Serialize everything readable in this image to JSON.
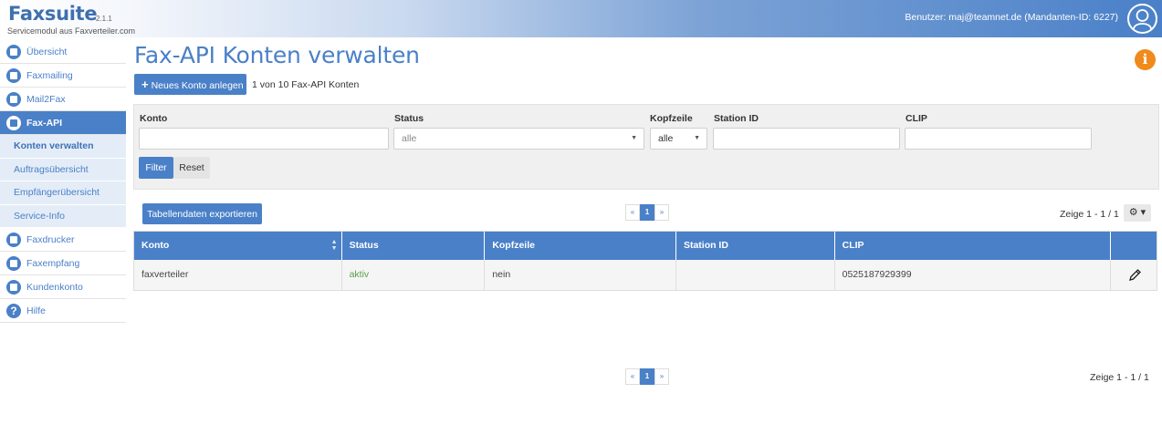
{
  "header": {
    "logo": "Faxsuite",
    "version": "2.1.1",
    "subtitle": "Servicemodul aus Faxverteiler.com",
    "user_info": "Benutzer: maj@teamnet.de (Mandanten-ID: 6227)",
    "avatar_icon": "user-icon"
  },
  "sidebar": {
    "items": [
      {
        "label": "Übersicht",
        "icon": "overview-icon"
      },
      {
        "label": "Faxmailing",
        "icon": "faxmailing-icon"
      },
      {
        "label": "Mail2Fax",
        "icon": "mail2fax-icon"
      },
      {
        "label": "Fax-API",
        "icon": "fax-api-icon"
      },
      {
        "label": "Faxdrucker",
        "icon": "faxdrucker-icon"
      },
      {
        "label": "Faxempfang",
        "icon": "faxempfang-icon"
      },
      {
        "label": "Kundenkonto",
        "icon": "kundenkonto-icon"
      },
      {
        "label": "Hilfe",
        "icon": "help-icon",
        "glyph": "?"
      }
    ],
    "subitems": [
      {
        "label": "Konten verwalten"
      },
      {
        "label": "Auftragsübersicht"
      },
      {
        "label": "Empfängerübersicht"
      },
      {
        "label": "Service-Info"
      }
    ]
  },
  "main": {
    "title": "Fax-API Konten verwalten",
    "info_glyph": "i",
    "new_account_plus": "+",
    "new_account_label": "Neues Konto anlegen",
    "count_text": "1 von 10 Fax-API Konten"
  },
  "filter": {
    "konto_label": "Konto",
    "konto_value": "",
    "status_label": "Status",
    "status_value": "alle",
    "kopfzeile_label": "Kopfzeile",
    "kopfzeile_value": "alle",
    "station_label": "Station ID",
    "station_value": "",
    "clip_label": "CLIP",
    "clip_value": "",
    "filter_button": "Filter",
    "reset_button": "Reset"
  },
  "table_toolbar": {
    "export_label": "Tabellendaten exportieren",
    "pager": {
      "prev": "«",
      "current": "1",
      "next": "»"
    },
    "show_text": "Zeige 1 - 1 / 1",
    "gear_label": "⚙ ▾"
  },
  "table": {
    "columns": [
      "Konto",
      "Status",
      "Kopfzeile",
      "Station ID",
      "CLIP",
      ""
    ],
    "rows": [
      {
        "konto": "faxverteiler",
        "status": "aktiv",
        "kopfzeile": "nein",
        "station_id": "",
        "clip": "0525187929399"
      }
    ]
  },
  "footer_pager": {
    "pager": {
      "prev": "«",
      "current": "1",
      "next": "»"
    },
    "show_text": "Zeige 1 - 1 / 1"
  },
  "colors": {
    "accent": "#4a80c8",
    "info": "#f08a1c",
    "status_active": "#5a9e4a"
  }
}
